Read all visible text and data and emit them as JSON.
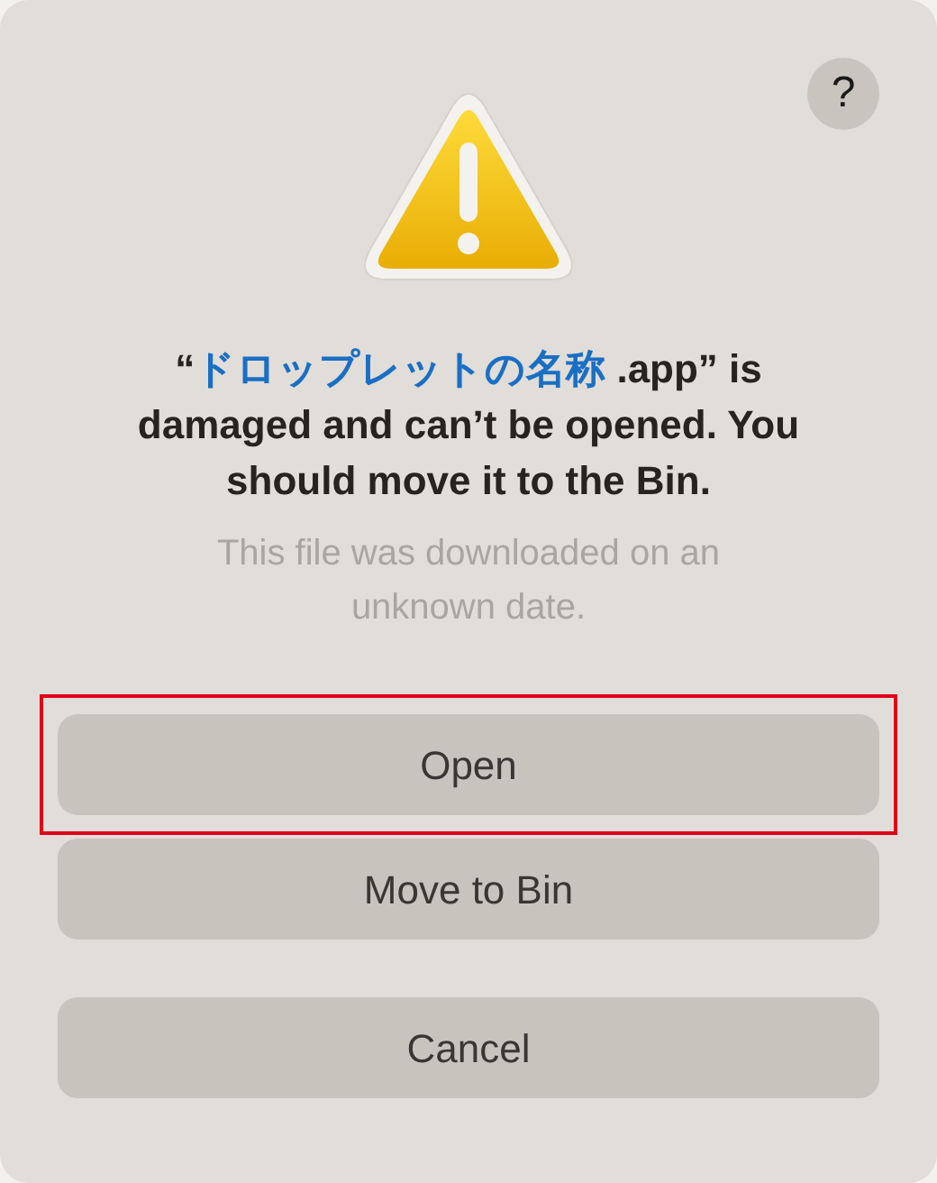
{
  "help_button": {
    "label": "?"
  },
  "title": {
    "prefix": "“",
    "app_name": "ドロップレットの名称",
    "suffix": " .app” is damaged and can’t be opened. You should move it to the Bin."
  },
  "message": "This file was downloaded on an unknown date.",
  "buttons": [
    {
      "label": "Open",
      "highlighted": true
    },
    {
      "label": "Move to Bin",
      "highlighted": false
    },
    {
      "label": "Cancel",
      "highlighted": false,
      "kind": "cancel"
    }
  ]
}
